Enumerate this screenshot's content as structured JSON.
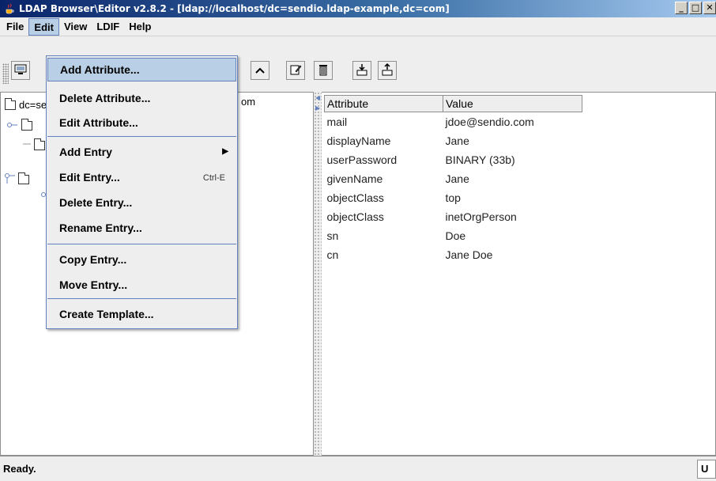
{
  "window": {
    "title": "LDAP Browser\\Editor v2.8.2 - [ldap://localhost/dc=sendio.ldap-example,dc=com]",
    "controls": {
      "minimize": "_",
      "maximize": "□",
      "close": "✕"
    }
  },
  "menubar": {
    "file": "File",
    "edit": "Edit",
    "view": "View",
    "ldif": "LDIF",
    "help": "Help"
  },
  "tree": {
    "root_label": "dc=sendio.ldap-example,dc=com",
    "visible_suffix": "om"
  },
  "edit_menu": {
    "items": [
      {
        "label": "Add Attribute..."
      },
      {
        "label": "Delete Attribute..."
      },
      {
        "label": "Edit Attribute..."
      },
      {
        "label": "Add Entry"
      },
      {
        "label": "Edit Entry...",
        "shortcut": "Ctrl-E"
      },
      {
        "label": "Delete Entry..."
      },
      {
        "label": "Rename Entry..."
      },
      {
        "label": "Copy Entry..."
      },
      {
        "label": "Move Entry..."
      },
      {
        "label": "Create Template..."
      }
    ]
  },
  "attributes": {
    "columns": [
      "Attribute",
      "Value"
    ],
    "rows": [
      {
        "attribute": "mail",
        "value": "jdoe@sendio.com"
      },
      {
        "attribute": "displayName",
        "value": "Jane"
      },
      {
        "attribute": "userPassword",
        "value": "BINARY (33b)"
      },
      {
        "attribute": "givenName",
        "value": "Jane"
      },
      {
        "attribute": "objectClass",
        "value": "top"
      },
      {
        "attribute": "objectClass",
        "value": "inetOrgPerson"
      },
      {
        "attribute": "sn",
        "value": "Doe"
      },
      {
        "attribute": "cn",
        "value": "Jane Doe"
      }
    ]
  },
  "status": {
    "text": "Ready.",
    "right_indicator": "U"
  },
  "icons": {
    "toolbar": [
      "connect-icon",
      "up-icon",
      "edit-entry-icon",
      "delete-icon",
      "export-icon",
      "import-icon"
    ],
    "app": "java-cup-icon"
  },
  "colors": {
    "titlebar": "#0a246a",
    "menu_highlight": "#b8cfe5",
    "menu_border": "#6382bf"
  }
}
